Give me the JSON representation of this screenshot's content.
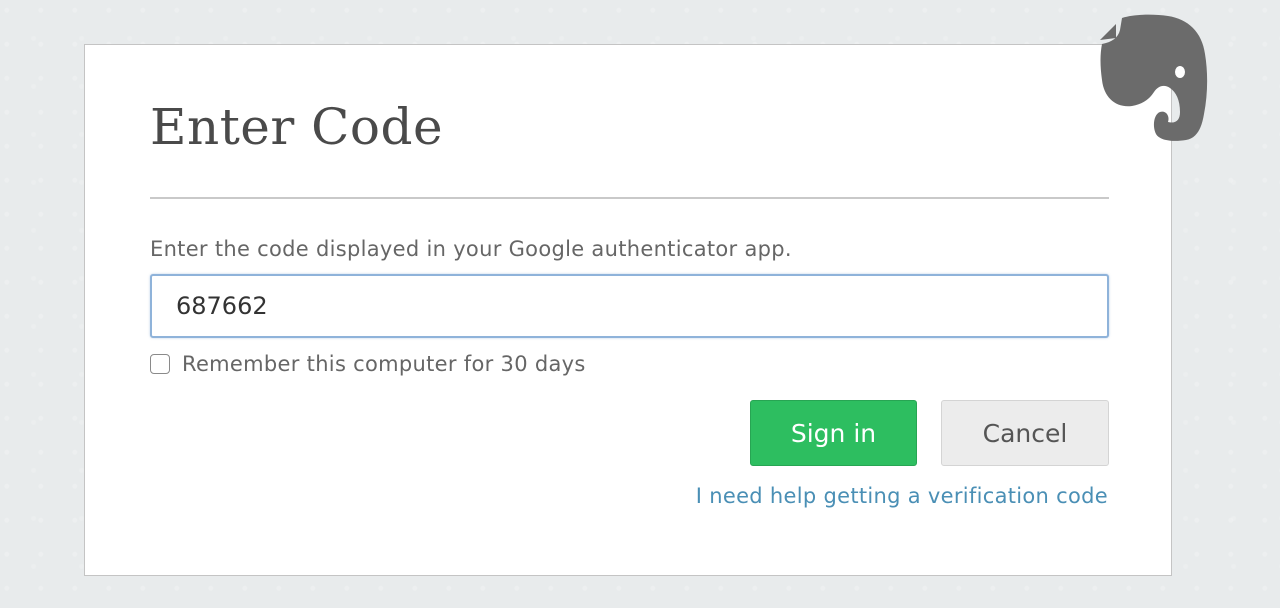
{
  "dialog": {
    "title": "Enter Code",
    "instruction": "Enter the code displayed in your Google authenticator app.",
    "code_value": "687662",
    "remember_label": "Remember this computer for 30 days",
    "remember_checked": false,
    "signin_label": "Sign in",
    "cancel_label": "Cancel",
    "help_link": "I need help getting a verification code"
  },
  "brand": {
    "logo_icon": "evernote-elephant-icon",
    "accent_color": "#2dbe60",
    "link_color": "#4a8fb5"
  }
}
